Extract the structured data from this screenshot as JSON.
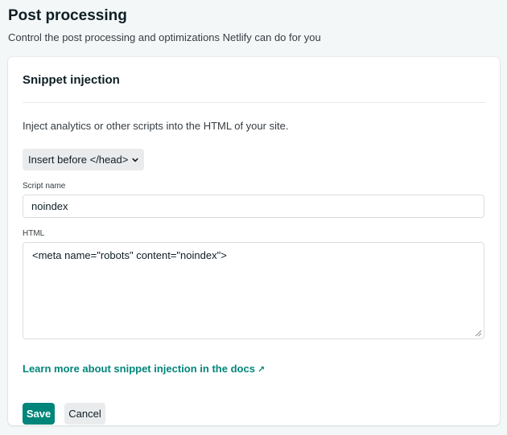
{
  "header": {
    "title": "Post processing",
    "subtitle": "Control the post processing and optimizations Netlify can do for you"
  },
  "card": {
    "title": "Snippet injection",
    "description": "Inject analytics or other scripts into the HTML of your site.",
    "position_select": {
      "value": "Insert before </head>"
    },
    "script_name": {
      "label": "Script name",
      "value": "noindex"
    },
    "html": {
      "label": "HTML",
      "value": "<meta name=\"robots\" content=\"noindex\">"
    },
    "docs_link": {
      "label": "Learn more about snippet injection in the docs",
      "arrow": "↗"
    },
    "actions": {
      "save_label": "Save",
      "cancel_label": "Cancel"
    }
  },
  "colors": {
    "accent": "#00857a",
    "background": "#f4f7f8",
    "button_secondary": "#e9ebed"
  }
}
